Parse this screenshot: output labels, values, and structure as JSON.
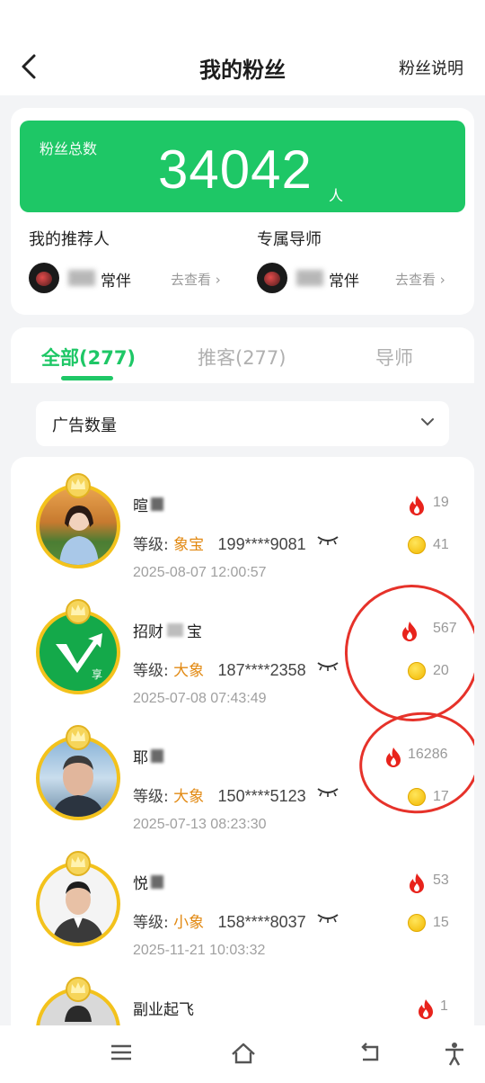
{
  "header": {
    "title": "我的粉丝",
    "explain_label": "粉丝说明"
  },
  "summary": {
    "label": "粉丝总数",
    "count": "34042",
    "unit": "人"
  },
  "referrer": {
    "title": "我的推荐人",
    "name": "常伴",
    "link": "去查看 ›"
  },
  "mentor": {
    "title": "专属导师",
    "name": "常伴",
    "link": "去查看 ›"
  },
  "tabs": [
    {
      "label": "全部(277)"
    },
    {
      "label": "推客(277)"
    },
    {
      "label": "导师"
    }
  ],
  "filter": {
    "selected": "广告数量"
  },
  "fans": [
    {
      "name": "暄",
      "level_label": "等级:",
      "level": "象宝",
      "phone": "199****9081",
      "time": "2025-08-07 12:00:57",
      "fire": "19",
      "coins": "41"
    },
    {
      "name": "招财",
      "name_tail": "宝",
      "level_label": "等级:",
      "level": "大象",
      "phone": "187****2358",
      "time": "2025-07-08 07:43:49",
      "fire": "567",
      "coins": "20"
    },
    {
      "name": "耶",
      "level_label": "等级:",
      "level": "大象",
      "phone": "150****5123",
      "time": "2025-07-13 08:23:30",
      "fire": "16286",
      "coins": "17"
    },
    {
      "name": "悦",
      "level_label": "等级:",
      "level": "小象",
      "phone": "158****8037",
      "time": "2025-11-21 10:03:32",
      "fire": "53",
      "coins": "15"
    },
    {
      "name": "副业起飞",
      "fire": "1"
    }
  ],
  "colors": {
    "brand_green": "#1ec766",
    "level_orange": "#e28a14",
    "annotation_red": "#e6322a"
  },
  "icons": [
    "back-icon",
    "chevron-down-icon",
    "eye-closed-icon",
    "fire-icon",
    "coin-icon",
    "crown-icon",
    "menu-icon",
    "home-icon",
    "return-icon",
    "accessibility-icon"
  ]
}
